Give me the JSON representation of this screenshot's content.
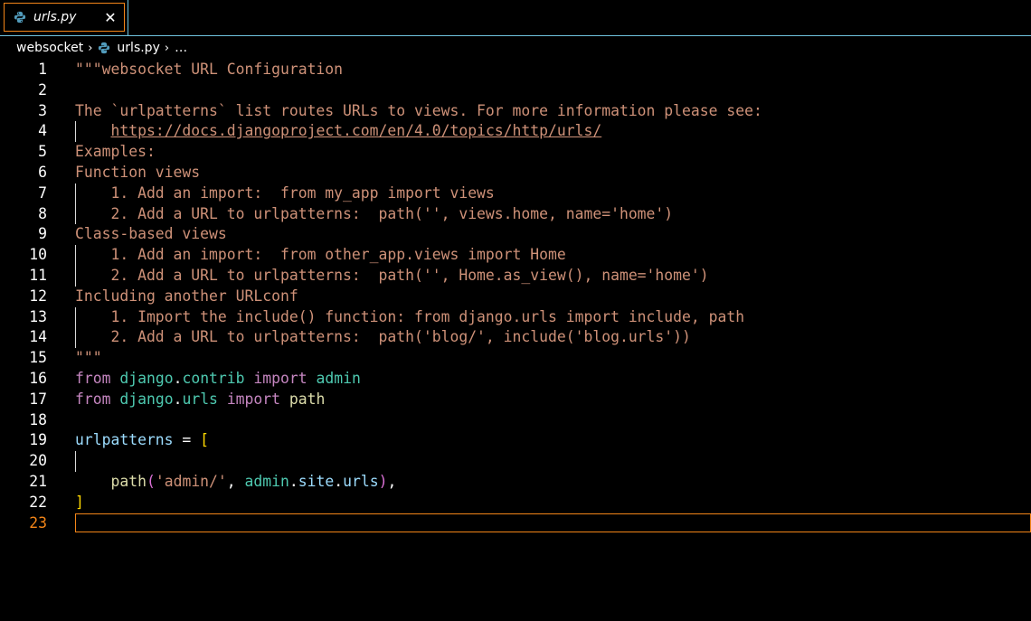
{
  "tab": {
    "label": "urls.py",
    "close_glyph": "✕",
    "icon": "python-icon"
  },
  "breadcrumb": {
    "folder": "websocket",
    "file": "urls.py",
    "more": "…"
  },
  "editor": {
    "active_line": "23",
    "lines": [
      {
        "n": "1"
      },
      {
        "n": "2"
      },
      {
        "n": "3"
      },
      {
        "n": "4"
      },
      {
        "n": "5"
      },
      {
        "n": "6"
      },
      {
        "n": "7"
      },
      {
        "n": "8"
      },
      {
        "n": "9"
      },
      {
        "n": "10"
      },
      {
        "n": "11"
      },
      {
        "n": "12"
      },
      {
        "n": "13"
      },
      {
        "n": "14"
      },
      {
        "n": "15"
      },
      {
        "n": "16"
      },
      {
        "n": "17"
      },
      {
        "n": "18"
      },
      {
        "n": "19"
      },
      {
        "n": "20"
      },
      {
        "n": "21"
      },
      {
        "n": "22"
      },
      {
        "n": "23"
      }
    ],
    "code": {
      "l1": "\"\"\"websocket URL Configuration",
      "l3": "The `urlpatterns` list routes URLs to views. For more information please see:",
      "l4_indent": "    ",
      "l4_url": "https://docs.djangoproject.com/en/4.0/topics/http/urls/",
      "l5": "Examples:",
      "l6": "Function views",
      "l7": "    1. Add an import:  from my_app import views",
      "l8": "    2. Add a URL to urlpatterns:  path('', views.home, name='home')",
      "l9": "Class-based views",
      "l10": "    1. Add an import:  from other_app.views import Home",
      "l11": "    2. Add a URL to urlpatterns:  path('', Home.as_view(), name='home')",
      "l12": "Including another URLconf",
      "l13": "    1. Import the include() function: from django.urls import include, path",
      "l14": "    2. Add a URL to urlpatterns:  path('blog/', include('blog.urls'))",
      "l15": "\"\"\"",
      "kw_from": "from",
      "kw_import": "import",
      "mod_django": "django",
      "dot": ".",
      "mod_contrib": "contrib",
      "name_admin": "admin",
      "mod_urls": "urls",
      "name_path": "path",
      "var_urlpatterns": "urlpatterns",
      "eq": " = ",
      "open_bracket": "[",
      "close_bracket": "]",
      "l21_indent": "    ",
      "fn_path": "path",
      "paren_open": "(",
      "str_admin": "'admin/'",
      "comma_sp": ", ",
      "attr_site": "site",
      "attr_urls": "urls",
      "paren_close": ")",
      "trail_comma": ","
    }
  },
  "colors": {
    "accent_border": "#f38518",
    "tab_separator": "#6fc3df",
    "string": "#ce9178",
    "keyword": "#c586c0",
    "module": "#4ec9b0",
    "variable": "#9cdcfe",
    "function": "#dcdcaa",
    "bracket_level1": "#ffd700",
    "bracket_level2": "#da70d6"
  }
}
